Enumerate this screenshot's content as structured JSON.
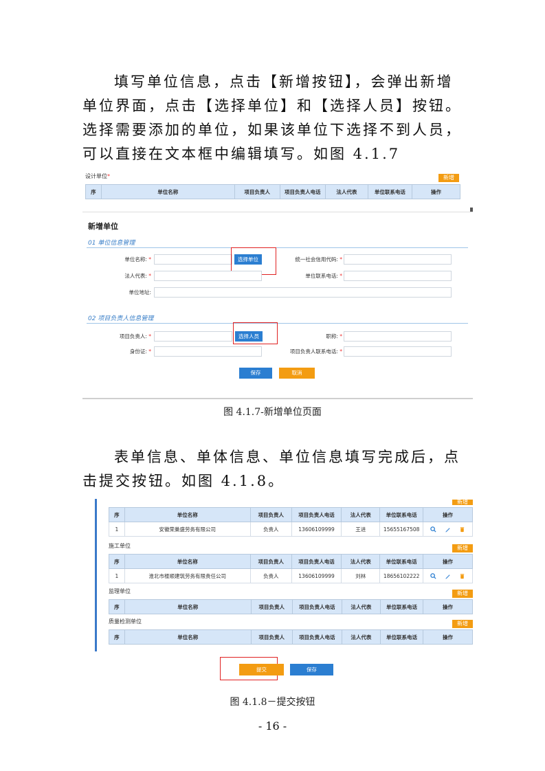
{
  "paragraph1": "填写单位信息，点击【新增按钮】，会弹出新增单位界面，点击【选择单位】和【选择人员】按钮。选择需要添加的单位，如果该单位下选择不到人员，可以直接在文本框中编辑填写。如图 4.1.7",
  "figure1": {
    "section_label": "设计单位",
    "required_mark": "*",
    "new_button": "新增",
    "columns": [
      "序",
      "单位名称",
      "项目负责人",
      "项目负责人电话",
      "法人代表",
      "单位联系电话",
      "操作"
    ],
    "modal": {
      "title": "新增单位",
      "section1": "01 单位信息管理",
      "section2": "02 项目负责人信息管理",
      "fields": {
        "unit_name": "单位名称:",
        "credit_code": "统一社会信用代码:",
        "legal_rep": "法人代表:",
        "unit_phone": "单位联系电话:",
        "unit_address": "单位地址:",
        "project_lead": "项目负责人:",
        "title": "职称:",
        "id_card": "身份证:",
        "lead_phone": "项目负责人联系电话:"
      },
      "select_unit_button": "选择单位",
      "select_person_button": "选择人员",
      "save_button": "保存",
      "cancel_button": "取消"
    },
    "caption": "图 4.1.7-新增单位页面"
  },
  "paragraph2": "表单信息、单体信息、单位信息填写完成后，点击提交按钮。如图 4.1.8。",
  "figure2": {
    "columns": [
      "序",
      "单位名称",
      "项目负责人",
      "项目负责人电话",
      "法人代表",
      "单位联系电话",
      "操作"
    ],
    "new_button": "新增",
    "sections": [
      {
        "label": "",
        "rows": [
          {
            "idx": "1",
            "name": "安徽荣巢盛劳务有限公司",
            "lead": "负责人",
            "lead_phone": "13606109999",
            "legal": "王进",
            "phone": "15655167508"
          }
        ]
      },
      {
        "label": "施工单位",
        "rows": [
          {
            "idx": "1",
            "name": "淮北市楼顺建筑劳务有限责任公司",
            "lead": "负责人",
            "lead_phone": "13606109999",
            "legal": "刘林",
            "phone": "18656102222"
          }
        ]
      },
      {
        "label": "监理单位",
        "rows": []
      },
      {
        "label": "质量检测单位",
        "rows": []
      }
    ],
    "submit_button": "提交",
    "save_button": "保存",
    "caption": "图 4.1.8－提交按钮"
  },
  "page_number": "- 16 -",
  "colors": {
    "accent_blue": "#2b7ed1",
    "accent_orange": "#f39c12",
    "header_blue": "#d6e6f8",
    "highlight_red": "#e02020"
  }
}
